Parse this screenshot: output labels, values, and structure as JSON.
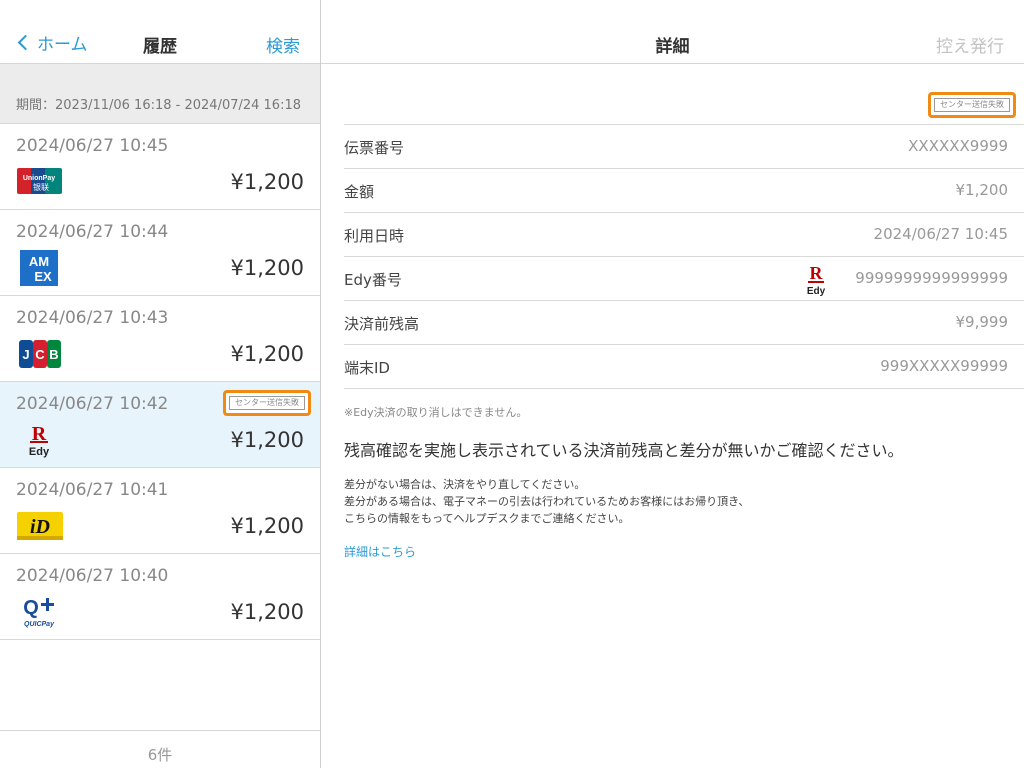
{
  "left_nav": {
    "back_label": "ホーム",
    "title": "履歴",
    "search_label": "検索"
  },
  "period": "期間：2023/11/06 16:18 - 2024/07/24 16:18",
  "history": [
    {
      "date": "2024/06/27 10:45",
      "amount": "¥1,200",
      "brand": "unionpay-logo",
      "brand_text_1": "UnionPay",
      "brand_text_2": "银联"
    },
    {
      "date": "2024/06/27 10:44",
      "amount": "¥1,200",
      "brand": "amex-logo",
      "brand_text_1": "AM",
      "brand_text_2": "EX"
    },
    {
      "date": "2024/06/27 10:43",
      "amount": "¥1,200",
      "brand": "jcb-logo",
      "brand_text_1": "J",
      "brand_text_2": "C",
      "brand_text_3": "B"
    },
    {
      "date": "2024/06/27 10:42",
      "amount": "¥1,200",
      "brand": "edy-logo",
      "brand_text_1": "R",
      "brand_text_2": "Edy",
      "status": "センター送信失敗",
      "selected": true
    },
    {
      "date": "2024/06/27 10:41",
      "amount": "¥1,200",
      "brand": "id-logo",
      "brand_text_1": "iD"
    },
    {
      "date": "2024/06/27 10:40",
      "amount": "¥1,200",
      "brand": "quicpay-logo",
      "brand_text_1": "Q",
      "brand_text_2": "QUICPay"
    }
  ],
  "footer_count": "6件",
  "right_nav": {
    "title": "詳細",
    "reissue_label": "控え発行"
  },
  "detail": {
    "status": "センター送信失敗",
    "rows": [
      {
        "label": "伝票番号",
        "value": "XXXXXX9999"
      },
      {
        "label": "金額",
        "value": "¥1,200"
      },
      {
        "label": "利用日時",
        "value": "2024/06/27 10:45"
      },
      {
        "label": "Edy番号",
        "value": "9999999999999999"
      },
      {
        "label": "決済前残高",
        "value": "¥9,999"
      },
      {
        "label": "端末ID",
        "value": "999XXXXX99999"
      }
    ],
    "note_cancel": "※Edy決済の取り消しはできません。",
    "note_main": "残高確認を実施し表示されている決済前残高と差分が無いかご確認ください。",
    "note_line1": "差分がない場合は、決済をやり直してください。",
    "note_line2": "差分がある場合は、電子マネーの引去は行われているためお客様にはお帰り頂き、",
    "note_line3": "こちらの情報をもってヘルプデスクまでご連絡ください。",
    "more_link": "詳細はこちら"
  },
  "colors": {
    "accent": "#2b9ad6",
    "warning_outline": "#f08a12",
    "selected_row": "#e8f4fb"
  }
}
